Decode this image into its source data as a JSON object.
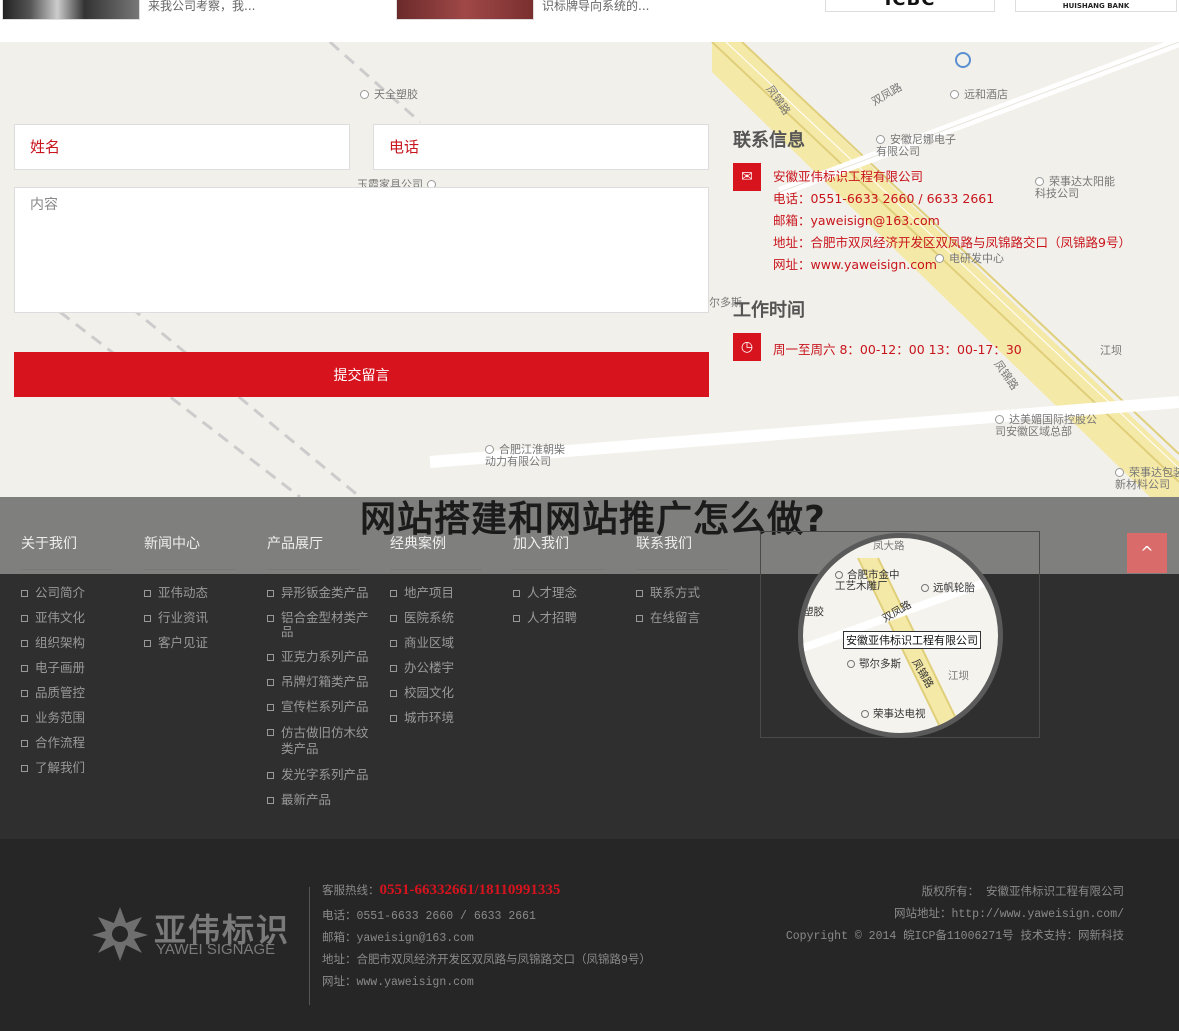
{
  "top_strip": {
    "snippet1": "来我公司考察，我...",
    "snippet2": "识标牌导向系统的...",
    "logo1": "ICBC",
    "logo2": "HUISHANG BANK"
  },
  "map": {
    "labels": [
      "天全塑胶",
      "远和酒店",
      "双凤路",
      "凤锦路",
      "安徽尼娜电子有限公司",
      "荣事达太阳能科技公司",
      "玉霞家具公司",
      "电研发中心",
      "尔多斯",
      "江坝",
      "凤锦路",
      "达美媚国际控股公司安徽区域总部",
      "合肥江淮朝柴动力有限公司",
      "荣事达包装新材料公司"
    ]
  },
  "form": {
    "name_placeholder": "姓名",
    "phone_placeholder": "电话",
    "content_placeholder": "内容",
    "submit_label": "提交留言"
  },
  "contact": {
    "title": "联系信息",
    "company": "安徽亚伟标识工程有限公司",
    "phone": "电话：0551-6633 2660 / 6633 2661",
    "email": "邮箱：yaweisign@163.com",
    "address": "地址：合肥市双凤经济开发区双凤路与凤锦路交口（凤锦路9号）",
    "website": "网址：www.yaweisign.com",
    "hours_title": "工作时间",
    "hours": "周一至周六 8：00-12：00 13：00-17：30"
  },
  "headline": "网站搭建和网站推广怎么做?",
  "footer_nav": {
    "columns": [
      {
        "title": "关于我们",
        "items": [
          "公司简介",
          "亚伟文化",
          "组织架构",
          "电子画册",
          "品质管控",
          "业务范围",
          "合作流程",
          "了解我们"
        ]
      },
      {
        "title": "新闻中心",
        "items": [
          "亚伟动态",
          "行业资讯",
          "客户见证"
        ]
      },
      {
        "title": "产品展厅",
        "items": [
          "异形钣金类产品",
          "铝合金型材类产品",
          "亚克力系列产品",
          "吊牌灯箱类产品",
          "宣传栏系列产品",
          "仿古做旧仿木纹类产品",
          "发光字系列产品",
          "最新产品"
        ]
      },
      {
        "title": "经典案例",
        "items": [
          "地产项目",
          "医院系统",
          "商业区域",
          "办公楼宇",
          "校园文化",
          "城市环境"
        ]
      },
      {
        "title": "加入我们",
        "items": [
          "人才理念",
          "人才招聘"
        ]
      },
      {
        "title": "联系我们",
        "items": [
          "联系方式",
          "在线留言"
        ]
      }
    ],
    "to_top": "^"
  },
  "mini_map": {
    "labels": [
      "凤大路",
      "合肥市金中工艺木雕厂",
      "远帆轮胎",
      "塑胶",
      "双凤路",
      "鄂尔多斯",
      "江坝",
      "凤锦路",
      "荣事达电视"
    ],
    "company": "安徽亚伟标识工程有限公司"
  },
  "bottom": {
    "brand_cn": "亚伟标识",
    "brand_en": "YAWEI SIGNAGE",
    "hotline_label": "客服热线：",
    "hotline_number": "0551-66332661/18110991335",
    "phone": "电话：0551-6633 2660 / 6633 2661",
    "email": "邮箱：yaweisign@163.com",
    "address": "地址：合肥市双凤经济开发区双凤路与凤锦路交口（凤锦路9号）",
    "website": "网址：www.yaweisign.com",
    "copyright_owner": "版权所有：  安徽亚伟标识工程有限公司",
    "site_url": "网站地址：http://www.yaweisign.com/",
    "icp": "Copyright © 2014 皖ICP备11006271号   技术支持：网新科技"
  }
}
